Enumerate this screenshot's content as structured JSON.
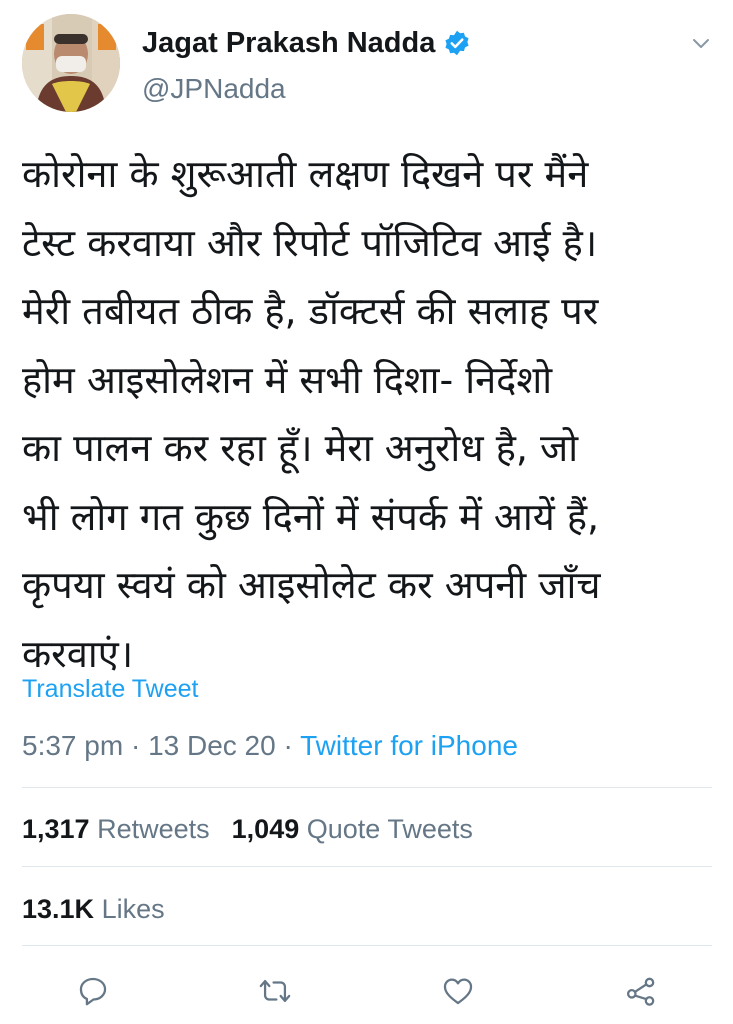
{
  "author": {
    "name": "Jagat Prakash Nadda",
    "handle": "@JPNadda",
    "avatar_icon": "profile-photo",
    "verified_icon": "verified-badge-icon"
  },
  "tweet": {
    "lines": [
      "कोरोना के शुरूआती लक्षण दिखने पर मैंने",
      "टेस्ट करवाया और रिपोर्ट पॉजिटिव आई है।",
      "मेरी तबीयत ठीक है, डॉक्टर्स की सलाह पर",
      "होम आइसोलेशन में सभी दिशा- निर्देशो",
      "का पालन कर रहा हूँ। मेरा अनुरोध है, जो",
      "भी लोग गत कुछ दिनों में संपर्क में आयें हैं,",
      "कृपया स्वयं को आइसोलेट कर अपनी जाँच",
      "करवाएं।"
    ],
    "translate_label": "Translate Tweet",
    "time": "5:37 pm",
    "separator": " · ",
    "date": "13 Dec 20",
    "source": "Twitter for iPhone"
  },
  "stats": {
    "retweets_count": "1,317",
    "retweets_label": "Retweets",
    "quote_count": "1,049",
    "quote_label": "Quote Tweets",
    "likes_count": "13.1K",
    "likes_label": "Likes"
  },
  "actions": {
    "reply_icon": "reply-icon",
    "retweet_icon": "retweet-icon",
    "like_icon": "heart-icon",
    "share_icon": "share-icon"
  },
  "colors": {
    "accent": "#1da1f2",
    "text": "#14171a",
    "muted": "#657786",
    "divider": "#e1e8ed"
  }
}
